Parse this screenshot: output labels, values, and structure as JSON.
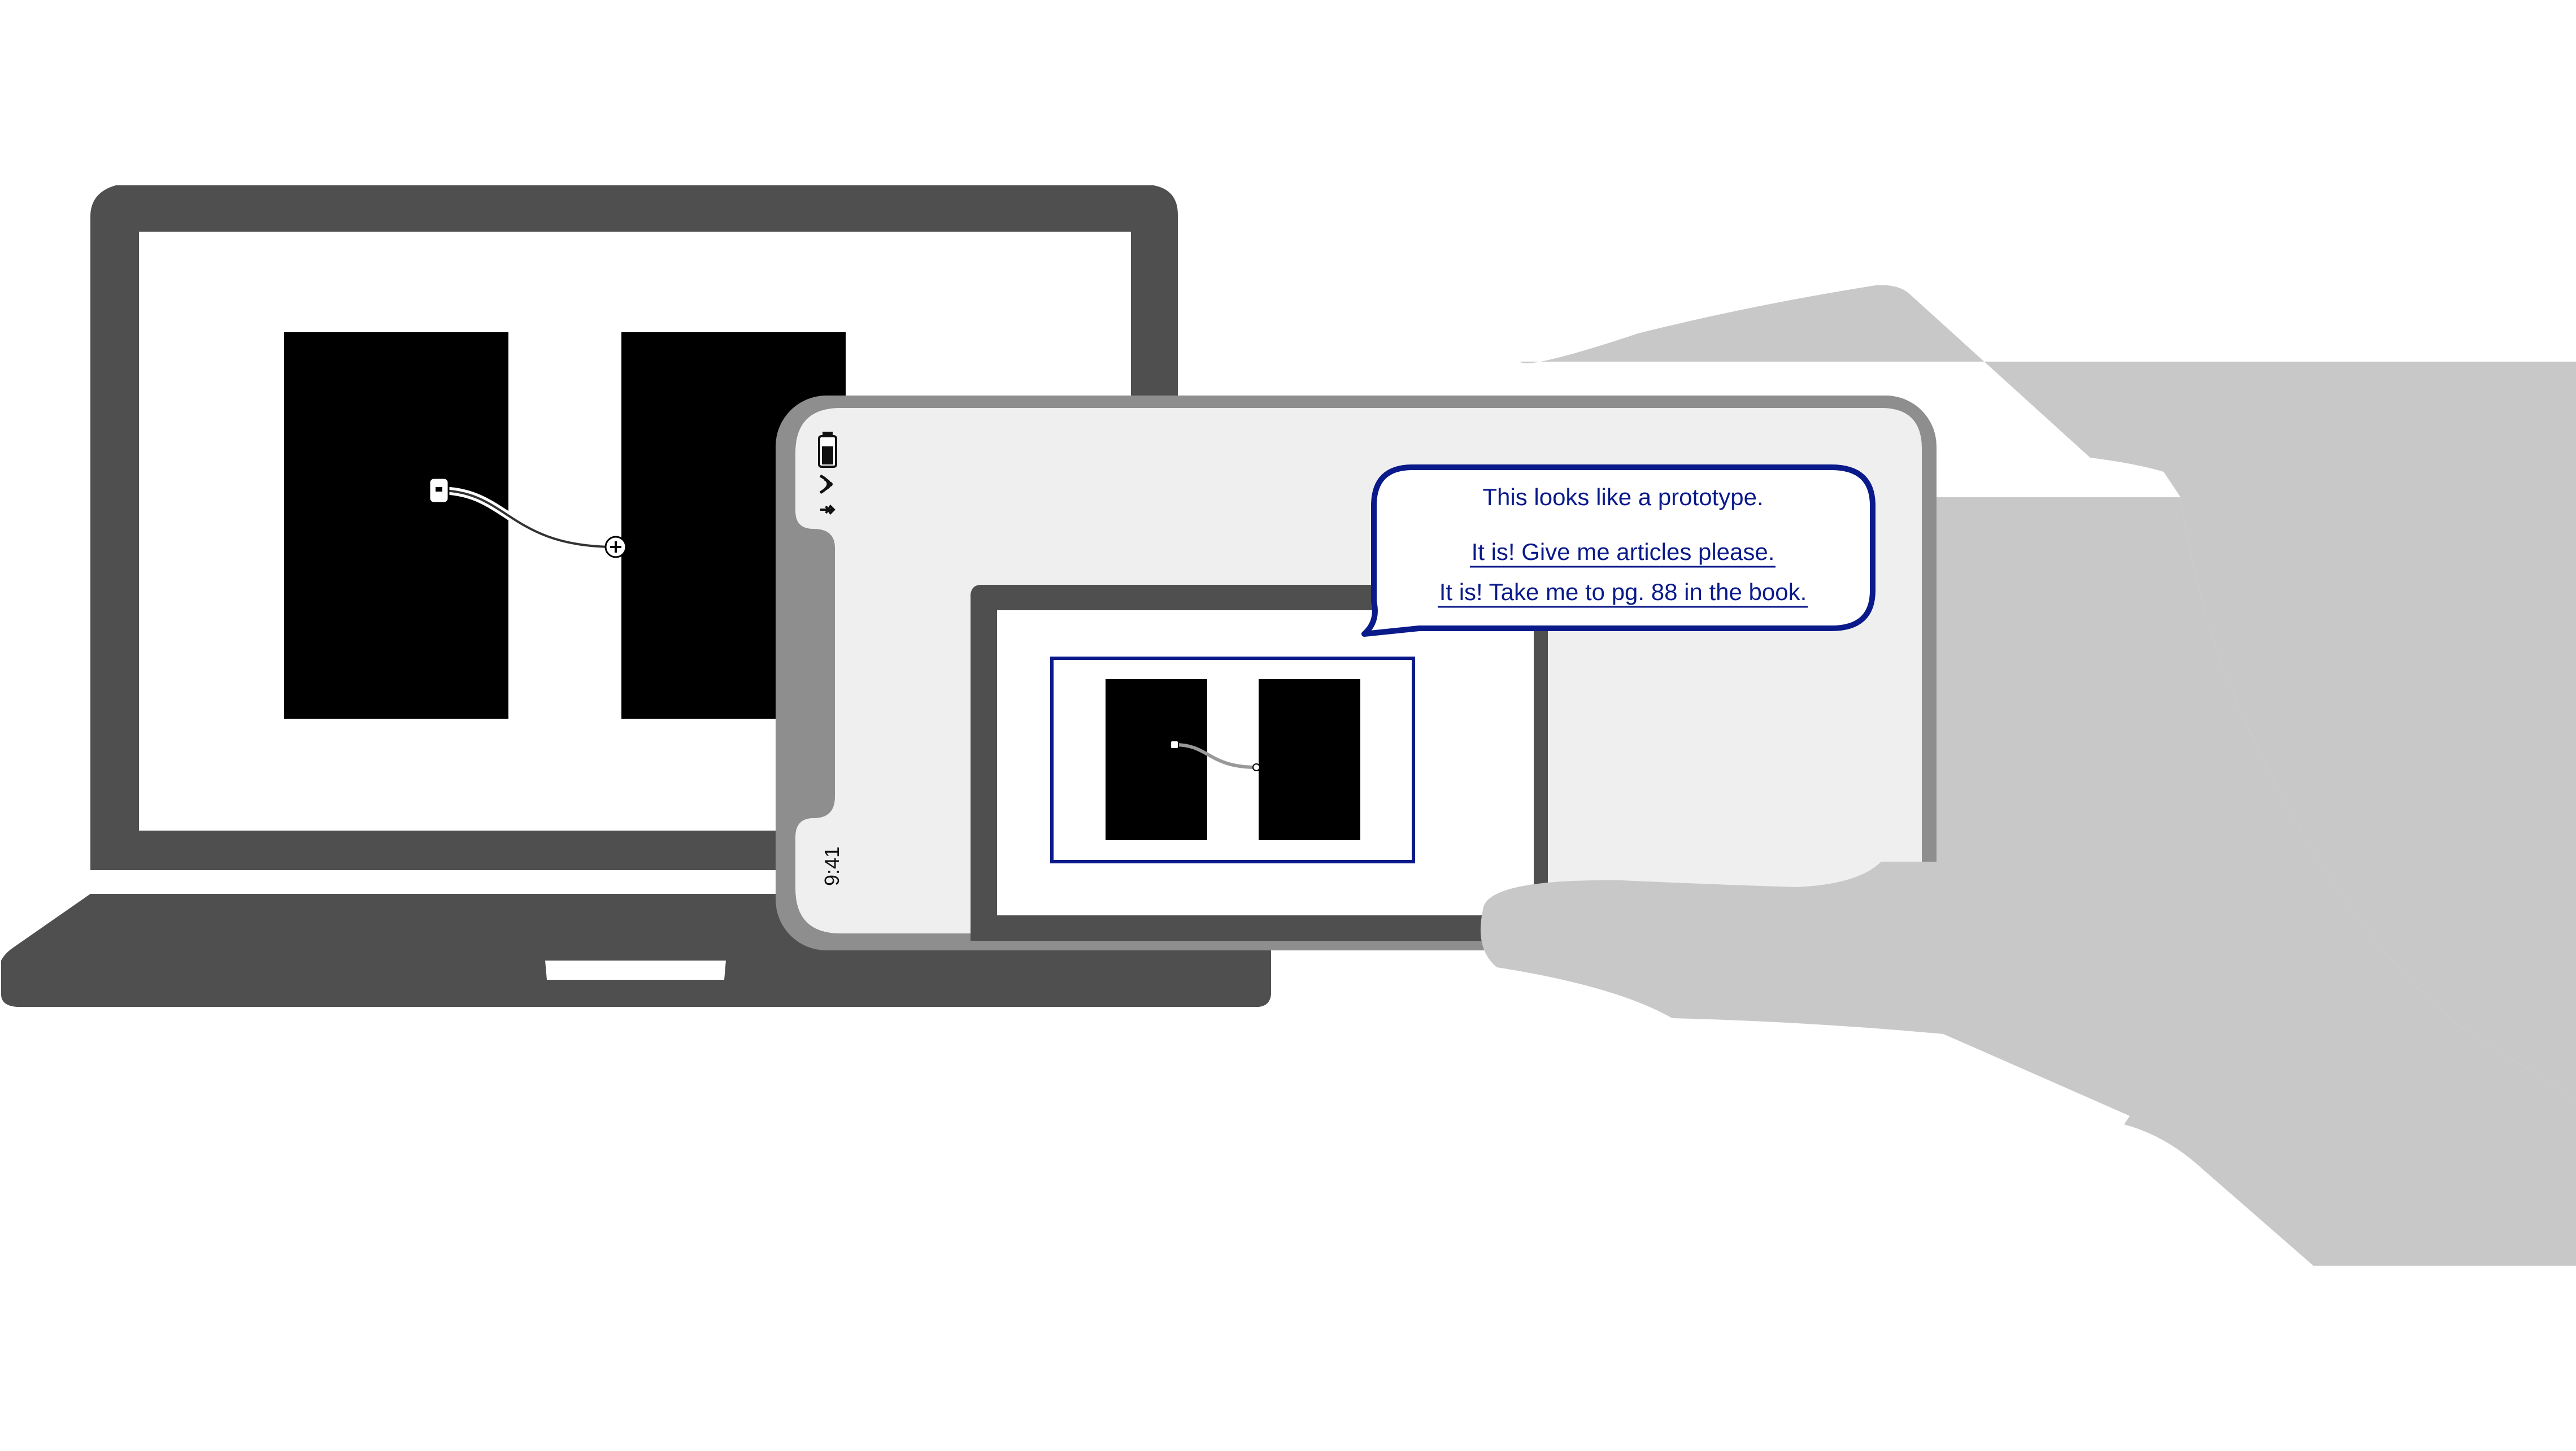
{
  "phone": {
    "status": {
      "time": "9:41",
      "battery_icon": "battery-icon",
      "wifi_icon": "wifi-icon",
      "bluetooth_icon": "bluetooth-icon"
    }
  },
  "bubble": {
    "message": "This looks like a prototype.",
    "options": [
      "It is! Give me articles please.",
      "It is! Take me to pg. 88 in the book."
    ]
  },
  "colors": {
    "device_body": "#4f4f4f",
    "phone_frame": "#8e8e8e",
    "phone_screen": "#efefef",
    "hand": "#c8c8c8",
    "highlight_frame": "#0a1a8a",
    "panel_black": "#000000"
  }
}
